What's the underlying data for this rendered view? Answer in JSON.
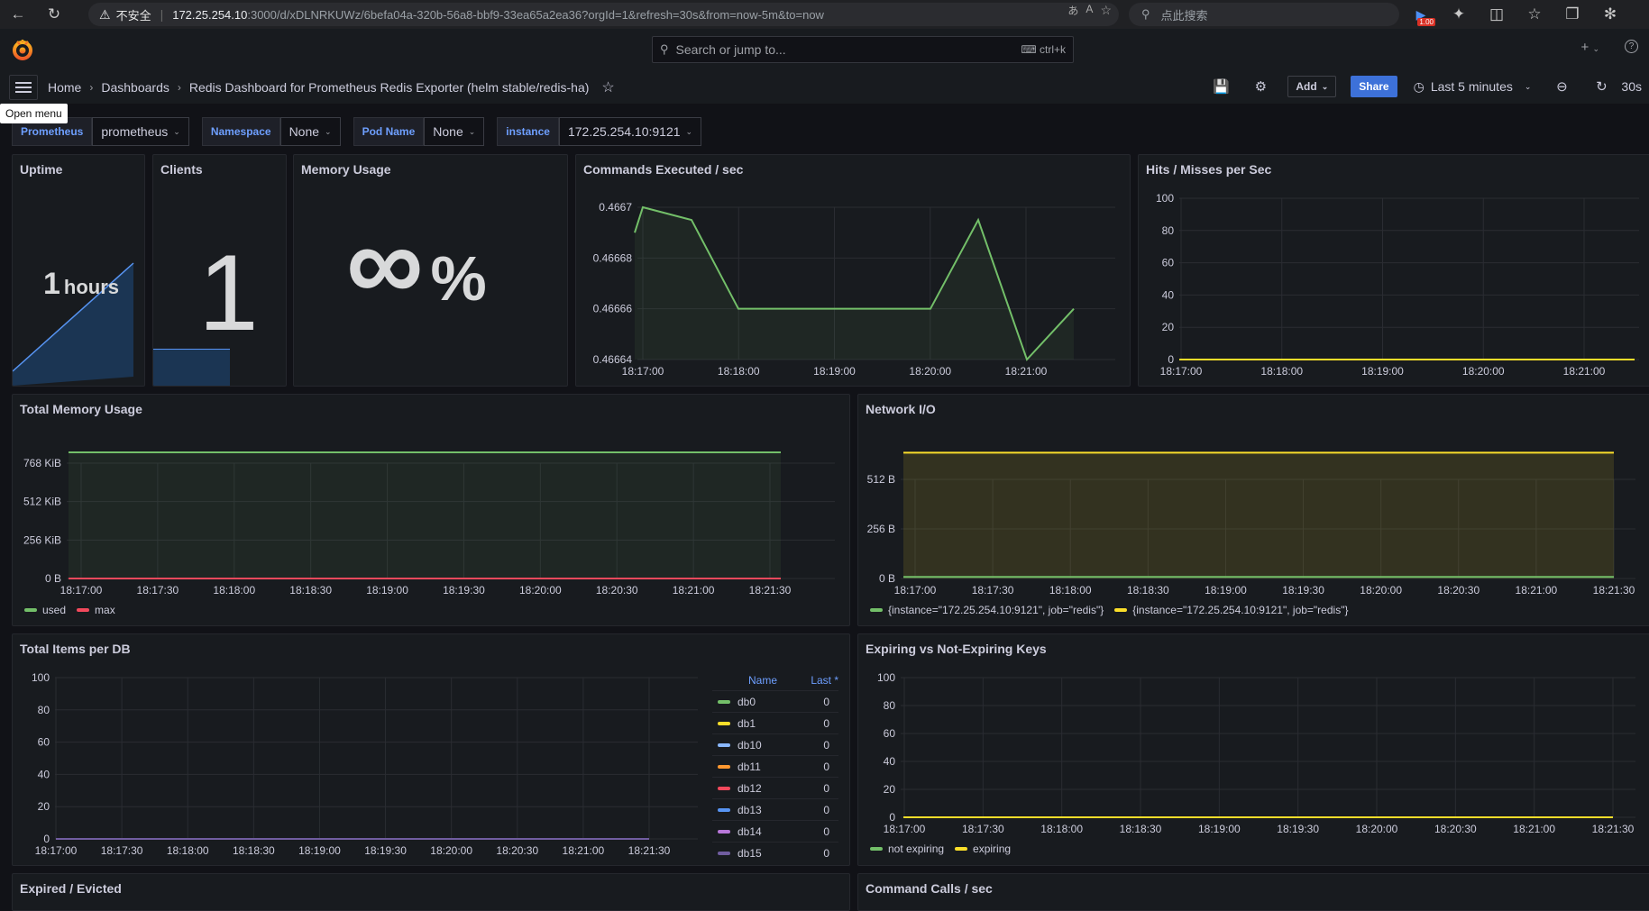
{
  "browser": {
    "insecure_label": "不安全",
    "url_host": "172.25.254.10",
    "url_rest": ":3000/d/xDLNRKUWz/6befa04a-320b-56a8-bbf9-33ea65a2ea36?orgId=1&refresh=30s&from=now-5m&to=now",
    "search_placeholder": "点此搜索",
    "badge": "1.00"
  },
  "nav": {
    "search_placeholder": "Search or jump to...",
    "shortcut": "ctrl+k"
  },
  "breadcrumb": {
    "home": "Home",
    "dashboards": "Dashboards",
    "current": "Redis Dashboard for Prometheus Redis Exporter (helm stable/redis-ha)"
  },
  "toolbar": {
    "add_label": "Add",
    "share_label": "Share",
    "time_range": "Last 5 minutes",
    "refresh": "30s"
  },
  "tooltip": "Open menu",
  "variables": [
    {
      "label": "Prometheus",
      "value": "prometheus"
    },
    {
      "label": "Namespace",
      "value": "None"
    },
    {
      "label": "Pod Name",
      "value": "None"
    },
    {
      "label": "instance",
      "value": "172.25.254.10:9121"
    }
  ],
  "panels": {
    "uptime": {
      "title": "Uptime",
      "value": "1",
      "unit": "hours"
    },
    "clients": {
      "title": "Clients",
      "value": "1"
    },
    "memory_usage": {
      "title": "Memory Usage",
      "value": "∞",
      "unit": "%"
    },
    "commands": {
      "title": "Commands Executed / sec"
    },
    "hits": {
      "title": "Hits / Misses per Sec"
    },
    "total_memory": {
      "title": "Total Memory Usage"
    },
    "network": {
      "title": "Network I/O"
    },
    "items_db": {
      "title": "Total Items per DB",
      "legend_name": "Name",
      "legend_last": "Last *"
    },
    "expiring": {
      "title": "Expiring vs Not-Expiring Keys"
    },
    "expired": {
      "title": "Expired / Evicted"
    },
    "command_calls": {
      "title": "Command Calls / sec"
    }
  },
  "chart_data": [
    {
      "type": "line",
      "title": "Commands Executed / sec",
      "x": [
        "18:16:45",
        "18:17:00",
        "18:17:30",
        "18:18:00",
        "18:18:30",
        "18:19:00",
        "18:19:30",
        "18:20:00",
        "18:20:30",
        "18:21:00",
        "18:21:15"
      ],
      "x_ticks": [
        "18:17:00",
        "18:18:00",
        "18:19:00",
        "18:20:00",
        "18:21:00"
      ],
      "y_ticks": [
        "0.4667",
        "0.46668",
        "0.46666",
        "0.46664"
      ],
      "ylim": [
        0.46664,
        0.4667
      ],
      "series": [
        {
          "color": "#73bf69",
          "values": [
            0.46669,
            0.4667,
            0.466695,
            0.46666,
            0.46666,
            0.46666,
            0.46666,
            0.46666,
            0.466695,
            0.46664,
            0.46666
          ]
        }
      ]
    },
    {
      "type": "line",
      "title": "Hits / Misses per Sec",
      "x_ticks": [
        "18:17:00",
        "18:18:00",
        "18:19:00",
        "18:20:00",
        "18:21:00"
      ],
      "y_ticks": [
        "100",
        "80",
        "60",
        "40",
        "20",
        "0"
      ],
      "ylim": [
        0,
        100
      ],
      "series": [
        {
          "color": "#fade2a",
          "values": [
            0,
            0
          ]
        }
      ]
    },
    {
      "type": "area",
      "title": "Total Memory Usage",
      "x_ticks": [
        "18:17:00",
        "18:17:30",
        "18:18:00",
        "18:18:30",
        "18:19:00",
        "18:19:30",
        "18:20:00",
        "18:20:30",
        "18:21:00",
        "18:21:30"
      ],
      "y_ticks": [
        "768 KiB",
        "512 KiB",
        "256 KiB",
        "0 B"
      ],
      "series": [
        {
          "name": "used",
          "color": "#73bf69",
          "value_kib": 840
        },
        {
          "name": "max",
          "color": "#f2495c",
          "value_kib": 0
        }
      ]
    },
    {
      "type": "area",
      "title": "Network I/O",
      "x_ticks": [
        "18:17:00",
        "18:17:30",
        "18:18:00",
        "18:18:30",
        "18:19:00",
        "18:19:30",
        "18:20:00",
        "18:20:30",
        "18:21:00",
        "18:21:30"
      ],
      "y_ticks": [
        "512 B",
        "256 B",
        "0 B"
      ],
      "series": [
        {
          "name": "{instance=\"172.25.254.10:9121\", job=\"redis\"}",
          "color": "#73bf69",
          "value_b": 8
        },
        {
          "name": "{instance=\"172.25.254.10:9121\", job=\"redis\"}",
          "color": "#fade2a",
          "value_b": 650
        }
      ]
    },
    {
      "type": "line",
      "title": "Total Items per DB",
      "x_ticks": [
        "18:17:00",
        "18:17:30",
        "18:18:00",
        "18:18:30",
        "18:19:00",
        "18:19:30",
        "18:20:00",
        "18:20:30",
        "18:21:00",
        "18:21:30"
      ],
      "y_ticks": [
        "100",
        "80",
        "60",
        "40",
        "20",
        "0"
      ],
      "series": [
        {
          "name": "db0",
          "color": "#73bf69",
          "last": "0"
        },
        {
          "name": "db1",
          "color": "#fade2a",
          "last": "0"
        },
        {
          "name": "db10",
          "color": "#8ab8ff",
          "last": "0"
        },
        {
          "name": "db11",
          "color": "#ff9830",
          "last": "0"
        },
        {
          "name": "db12",
          "color": "#f2495c",
          "last": "0"
        },
        {
          "name": "db13",
          "color": "#5794f2",
          "last": "0"
        },
        {
          "name": "db14",
          "color": "#b877d9",
          "last": "0"
        },
        {
          "name": "db15",
          "color": "#705da0",
          "last": "0"
        }
      ]
    },
    {
      "type": "line",
      "title": "Expiring vs Not-Expiring Keys",
      "x_ticks": [
        "18:17:00",
        "18:17:30",
        "18:18:00",
        "18:18:30",
        "18:19:00",
        "18:19:30",
        "18:20:00",
        "18:20:30",
        "18:21:00",
        "18:21:30"
      ],
      "y_ticks": [
        "100",
        "80",
        "60",
        "40",
        "20",
        "0"
      ],
      "series": [
        {
          "name": "not expiring",
          "color": "#73bf69",
          "value": 0
        },
        {
          "name": "expiring",
          "color": "#fade2a",
          "value": 0
        }
      ]
    }
  ]
}
